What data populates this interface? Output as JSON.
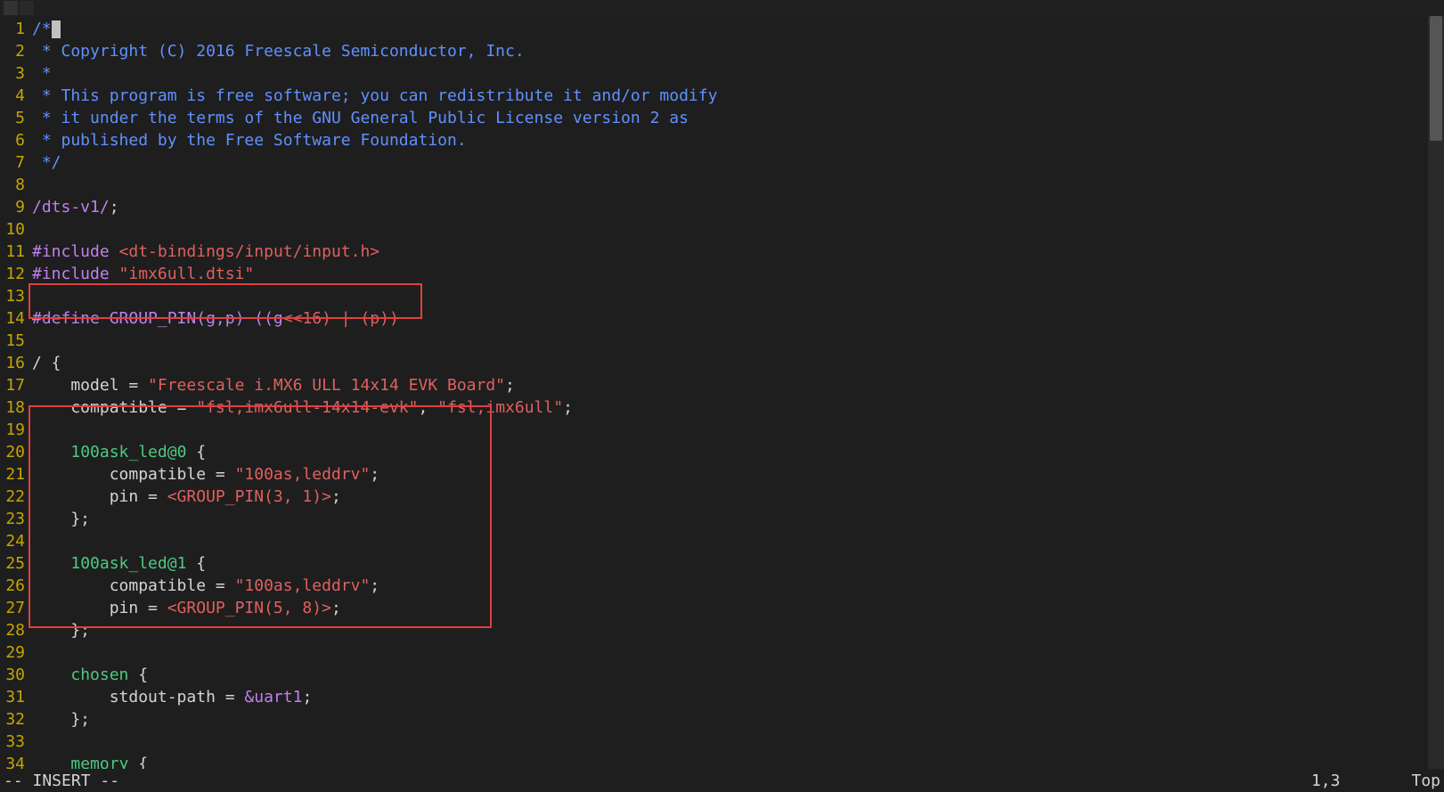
{
  "tabs": [
    {
      "label": ""
    },
    {
      "label": ""
    }
  ],
  "status": {
    "mode": "-- INSERT --",
    "pos": "1,3",
    "loc": "Top"
  },
  "lines": [
    {
      "n": "1",
      "seg": [
        {
          "c": "c-comment",
          "t": "/*"
        },
        {
          "c": "cursor",
          "t": ""
        }
      ]
    },
    {
      "n": "2",
      "seg": [
        {
          "c": "c-comment",
          "t": " * Copyright (C) 2016 Freescale Semiconductor, Inc."
        }
      ]
    },
    {
      "n": "3",
      "seg": [
        {
          "c": "c-comment",
          "t": " *"
        }
      ]
    },
    {
      "n": "4",
      "seg": [
        {
          "c": "c-comment",
          "t": " * This program is free software; you can redistribute it and/or modify"
        }
      ]
    },
    {
      "n": "5",
      "seg": [
        {
          "c": "c-comment",
          "t": " * it under the terms of the GNU General Public License version 2 as"
        }
      ]
    },
    {
      "n": "6",
      "seg": [
        {
          "c": "c-comment",
          "t": " * published by the Free Software Foundation."
        }
      ]
    },
    {
      "n": "7",
      "seg": [
        {
          "c": "c-comment",
          "t": " */"
        }
      ]
    },
    {
      "n": "8",
      "seg": [
        {
          "c": "c-white",
          "t": ""
        }
      ]
    },
    {
      "n": "9",
      "seg": [
        {
          "c": "c-purple",
          "t": "/dts-v1/"
        },
        {
          "c": "c-white",
          "t": ";"
        }
      ]
    },
    {
      "n": "10",
      "seg": [
        {
          "c": "c-white",
          "t": ""
        }
      ]
    },
    {
      "n": "11",
      "seg": [
        {
          "c": "c-purple",
          "t": "#include "
        },
        {
          "c": "c-red",
          "t": "<dt-bindings/input/input.h>"
        }
      ]
    },
    {
      "n": "12",
      "seg": [
        {
          "c": "c-purple",
          "t": "#include "
        },
        {
          "c": "c-red",
          "t": "\"imx6ull.dtsi\""
        }
      ]
    },
    {
      "n": "13",
      "seg": [
        {
          "c": "c-white",
          "t": ""
        }
      ]
    },
    {
      "n": "14",
      "seg": [
        {
          "c": "c-purple",
          "t": "#define GROUP_PIN(g,p) ((g"
        },
        {
          "c": "c-red",
          "t": "<<16) | (p))"
        }
      ]
    },
    {
      "n": "15",
      "seg": [
        {
          "c": "c-white",
          "t": ""
        }
      ]
    },
    {
      "n": "16",
      "seg": [
        {
          "c": "c-white",
          "t": "/ {"
        }
      ]
    },
    {
      "n": "17",
      "seg": [
        {
          "c": "c-white",
          "t": "    model = "
        },
        {
          "c": "c-red",
          "t": "\"Freescale i.MX6 ULL 14x14 EVK Board\""
        },
        {
          "c": "c-white",
          "t": ";"
        }
      ]
    },
    {
      "n": "18",
      "seg": [
        {
          "c": "c-white",
          "t": "    compatible = "
        },
        {
          "c": "c-red",
          "t": "\"fsl,imx6ull-14x14-evk\""
        },
        {
          "c": "c-white",
          "t": ", "
        },
        {
          "c": "c-red",
          "t": "\"fsl,imx6ull\""
        },
        {
          "c": "c-white",
          "t": ";"
        }
      ]
    },
    {
      "n": "19",
      "seg": [
        {
          "c": "c-white",
          "t": ""
        }
      ]
    },
    {
      "n": "20",
      "seg": [
        {
          "c": "c-white",
          "t": "    "
        },
        {
          "c": "c-green",
          "t": "100ask_led@0"
        },
        {
          "c": "c-white",
          "t": " {"
        }
      ]
    },
    {
      "n": "21",
      "seg": [
        {
          "c": "c-white",
          "t": "        compatible = "
        },
        {
          "c": "c-red",
          "t": "\"100as,leddrv\""
        },
        {
          "c": "c-white",
          "t": ";"
        }
      ]
    },
    {
      "n": "22",
      "seg": [
        {
          "c": "c-white",
          "t": "        pin = "
        },
        {
          "c": "c-red",
          "t": "<GROUP_PIN(3, 1)>"
        },
        {
          "c": "c-white",
          "t": ";"
        }
      ]
    },
    {
      "n": "23",
      "seg": [
        {
          "c": "c-white",
          "t": "    };"
        }
      ]
    },
    {
      "n": "24",
      "seg": [
        {
          "c": "c-white",
          "t": ""
        }
      ]
    },
    {
      "n": "25",
      "seg": [
        {
          "c": "c-white",
          "t": "    "
        },
        {
          "c": "c-green",
          "t": "100ask_led@1"
        },
        {
          "c": "c-white",
          "t": " {"
        }
      ]
    },
    {
      "n": "26",
      "seg": [
        {
          "c": "c-white",
          "t": "        compatible = "
        },
        {
          "c": "c-red",
          "t": "\"100as,leddrv\""
        },
        {
          "c": "c-white",
          "t": ";"
        }
      ]
    },
    {
      "n": "27",
      "seg": [
        {
          "c": "c-white",
          "t": "        pin = "
        },
        {
          "c": "c-red",
          "t": "<GROUP_PIN(5, 8)>"
        },
        {
          "c": "c-white",
          "t": ";"
        }
      ]
    },
    {
      "n": "28",
      "seg": [
        {
          "c": "c-white",
          "t": "    };"
        }
      ]
    },
    {
      "n": "29",
      "seg": [
        {
          "c": "c-white",
          "t": ""
        }
      ]
    },
    {
      "n": "30",
      "seg": [
        {
          "c": "c-white",
          "t": "    "
        },
        {
          "c": "c-green",
          "t": "chosen"
        },
        {
          "c": "c-white",
          "t": " {"
        }
      ]
    },
    {
      "n": "31",
      "seg": [
        {
          "c": "c-white",
          "t": "        stdout-path = "
        },
        {
          "c": "c-purple",
          "t": "&uart1"
        },
        {
          "c": "c-white",
          "t": ";"
        }
      ]
    },
    {
      "n": "32",
      "seg": [
        {
          "c": "c-white",
          "t": "    };"
        }
      ]
    },
    {
      "n": "33",
      "seg": [
        {
          "c": "c-white",
          "t": ""
        }
      ]
    },
    {
      "n": "34",
      "seg": [
        {
          "c": "c-white",
          "t": "    "
        },
        {
          "c": "c-green",
          "t": "memory"
        },
        {
          "c": "c-white",
          "t": " {"
        }
      ]
    }
  ]
}
